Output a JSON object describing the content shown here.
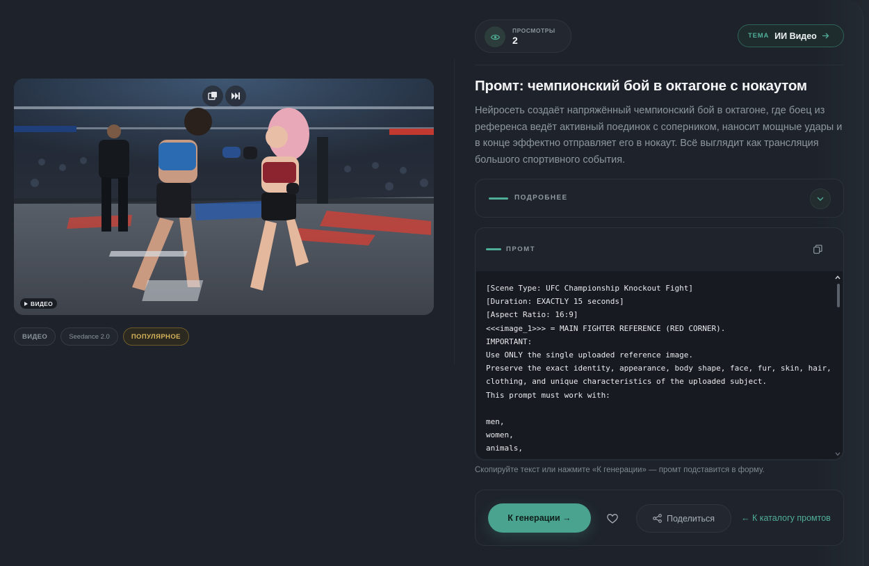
{
  "media": {
    "badge": "ВИДЕО",
    "controls": [
      "picture-in-picture-icon",
      "skip-forward-icon"
    ]
  },
  "tags": [
    "ВИДЕО",
    "Seedance 2.0",
    "ПОПУЛЯРНОЕ"
  ],
  "stats": {
    "views_label": "ПРОСМОТРЫ",
    "views_value": "2"
  },
  "theme": {
    "label": "ТЕМА",
    "value": "ИИ Видео"
  },
  "title": "Промт: чемпионский бой в октагоне с нокаутом",
  "description": "Нейросеть создаёт напряжённый чемпионский бой в октагоне, где боец из референса ведёт активный поединок с соперником, наносит мощные удары и в конце эффектно отправляет его в нокаут. Всё выглядит как трансляция большого спортивного события.",
  "details": {
    "label": "ПОДРОБНЕЕ"
  },
  "prompt": {
    "label": "ПРОМТ",
    "text": "[Scene Type: UFC Championship Knockout Fight]\n[Duration: EXACTLY 15 seconds]\n[Aspect Ratio: 16:9]\n<<<image_1>>> = MAIN FIGHTER REFERENCE (RED CORNER).\nIMPORTANT:\nUse ONLY the single uploaded reference image.\nPreserve the exact identity, appearance, body shape, face, fur, skin, hair,\nclothing, and unique characteristics of the uploaded subject.\nThis prompt must work with:\n\nmen,\nwomen,\nanimals,\nfantasy creatures,"
  },
  "hint": "Скопируйте текст или нажмите «К генерации» — промт подставится в форму.",
  "actions": {
    "generate": "К генерации →",
    "share": "Поделиться",
    "back": "← К каталогу промтов"
  },
  "colors": {
    "accent": "#4fae97",
    "popular": "#d8b45a",
    "background": "#1e232b"
  }
}
